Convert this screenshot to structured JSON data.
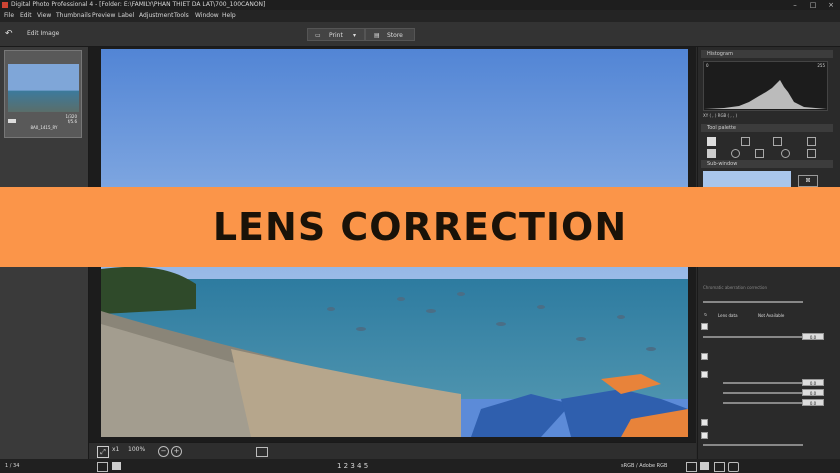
{
  "window": {
    "title": "Digital Photo Professional 4 - [Folder: E:\\FAMILY\\PHAN THIET DA LAT\\700_100CANON]"
  },
  "menu": [
    "File",
    "Edit",
    "View",
    "Thumbnails",
    "Preview",
    "Label",
    "Adjustment",
    "Tools",
    "Window",
    "Help"
  ],
  "toolbar": {
    "back_icon": "undo-arrow-icon",
    "edit_image_label": "Edit Image",
    "print_label": "Print",
    "store_label": "Store"
  },
  "thumbnail": {
    "filename": "8A0_1415_RY",
    "info_line1": "1/320",
    "info_line2": "f/5.6"
  },
  "right_panel": {
    "histogram_title": "Histogram",
    "hist_min": "0",
    "hist_max": "255",
    "readout": "XY (  ,  )  RGB (  ,  ,  )",
    "tool_palette_title": "Tool palette",
    "subwindow_title": "Sub-window",
    "lens_section_title": "Chromatic aberration correction",
    "lens_data_label": "Lens data",
    "lens_data_value": "Not Available",
    "values": [
      "0.0",
      "0.0",
      "0.0",
      "0.0"
    ]
  },
  "bottom_bar": {
    "zoom_value": "100%",
    "zoom_1x": "x1"
  },
  "status": {
    "counter": "1 / 34",
    "rating": "1 2 3 4 5",
    "color_space": "sRGB / Adobe RGB"
  },
  "banner": {
    "text": "LENS CORRECTION",
    "background": "#fb9549",
    "text_color": "#1a1208"
  }
}
